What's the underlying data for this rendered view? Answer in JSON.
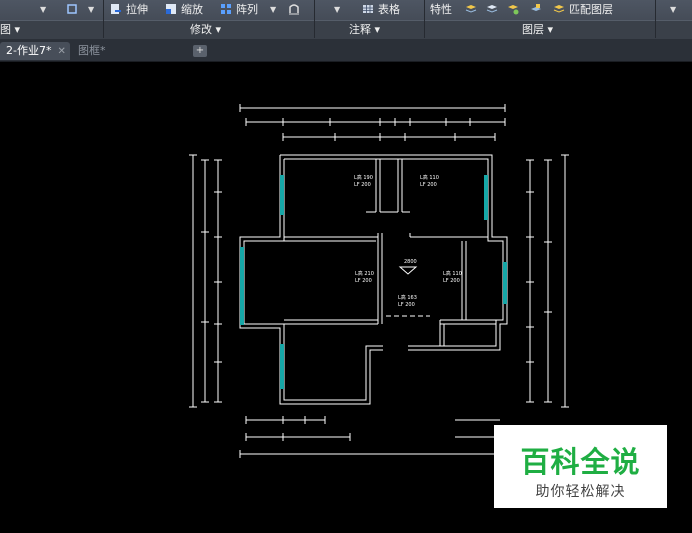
{
  "ribbon": {
    "tools": {
      "stretch": "拉伸",
      "scale": "缩放",
      "array": "阵列",
      "table": "表格",
      "properties": "特性",
      "match_layer": "匹配图层"
    },
    "groups": {
      "draw": "图 ▾",
      "modify": "修改 ▾",
      "annotate": "注释 ▾",
      "layers": "图层 ▾"
    }
  },
  "tabs": [
    {
      "label": "2-作业7*",
      "close": "✕",
      "active": true
    },
    {
      "label": "图框*",
      "active": false
    }
  ],
  "new_tab": "+",
  "drawing": {
    "labels": {
      "room1": [
        "L高 190",
        "LF 200"
      ],
      "room2": [
        "L高 110",
        "LF 200"
      ],
      "room3": [
        "L高 210",
        "LF 200"
      ],
      "room4": [
        "L高 110",
        "LF 200"
      ],
      "room5": [
        "L高 163",
        "LF 200"
      ],
      "elevation": "2800"
    },
    "colors": {
      "wall": "#ffffff",
      "window": "#16a7a7"
    }
  },
  "watermark": {
    "title": "百科全说",
    "subtitle": "助你轻松解决"
  }
}
